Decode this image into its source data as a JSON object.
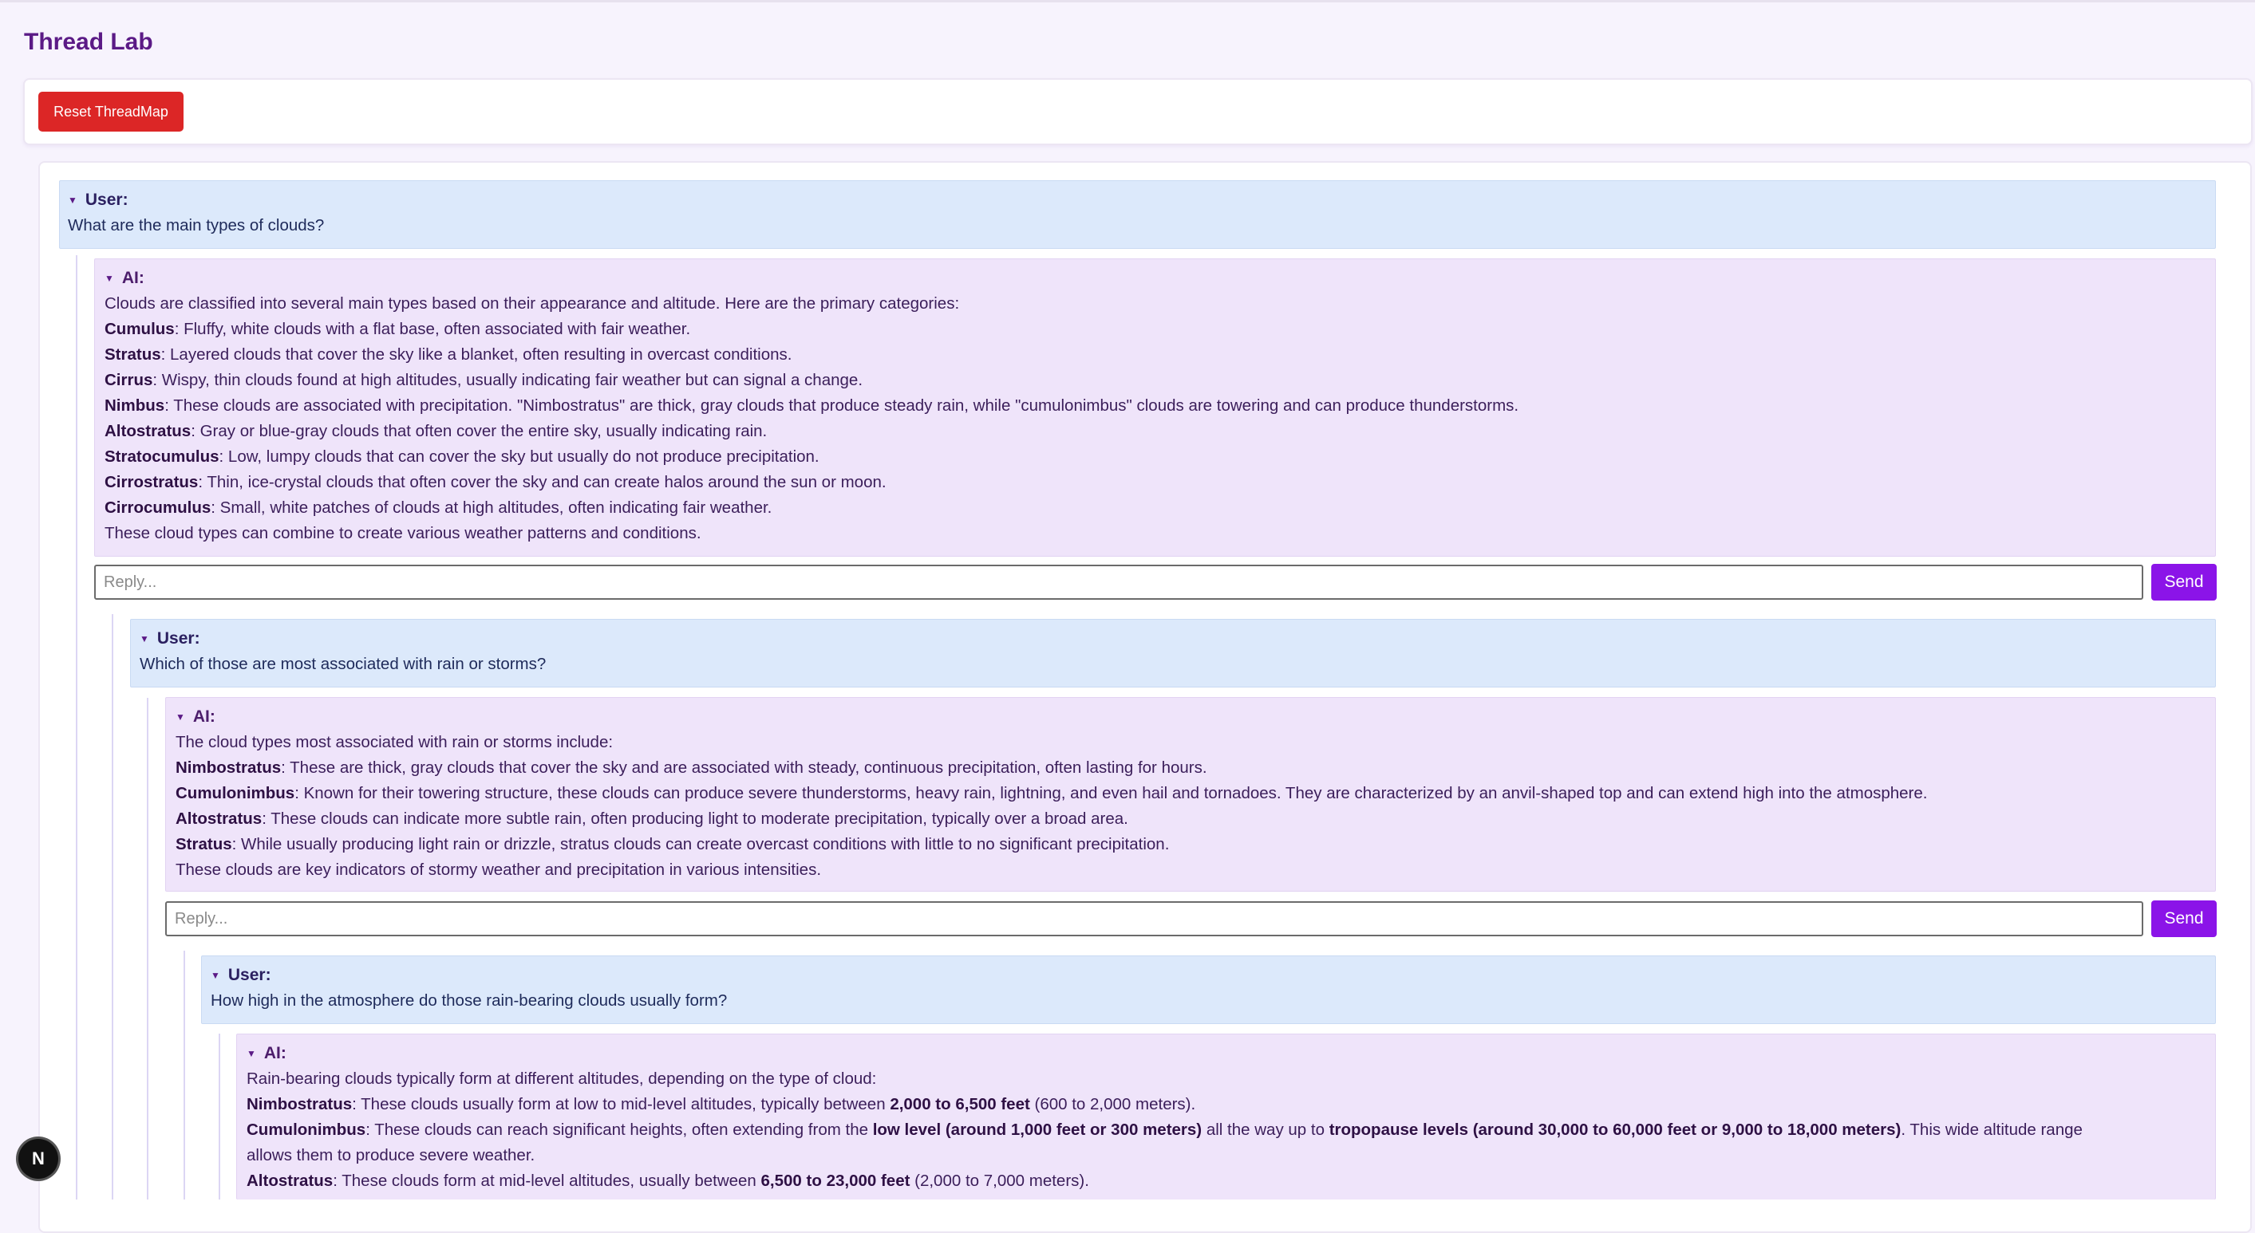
{
  "app": {
    "title": "Thread Lab",
    "reset_label": "Reset ThreadMap",
    "next_badge": "N"
  },
  "thread": {
    "q1": {
      "role": "User:",
      "text": "What are the main types of clouds?"
    },
    "a1": {
      "role": "AI:",
      "intro": "Clouds are classified into several main types based on their appearance and altitude. Here are the primary categories:",
      "items": [
        {
          "term": "Cumulus",
          "text": ": Fluffy, white clouds with a flat base, often associated with fair weather."
        },
        {
          "term": "Stratus",
          "text": ": Layered clouds that cover the sky like a blanket, often resulting in overcast conditions."
        },
        {
          "term": "Cirrus",
          "text": ": Wispy, thin clouds found at high altitudes, usually indicating fair weather but can signal a change."
        },
        {
          "term": "Nimbus",
          "text": ": These clouds are associated with precipitation. \"Nimbostratus\" are thick, gray clouds that produce steady rain, while \"cumulonimbus\" clouds are towering and can produce thunderstorms."
        },
        {
          "term": "Altostratus",
          "text": ": Gray or blue-gray clouds that often cover the entire sky, usually indicating rain."
        },
        {
          "term": "Stratocumulus",
          "text": ": Low, lumpy clouds that can cover the sky but usually do not produce precipitation."
        },
        {
          "term": "Cirrostratus",
          "text": ": Thin, ice-crystal clouds that often cover the sky and can create halos around the sun or moon."
        },
        {
          "term": "Cirrocumulus",
          "text": ": Small, white patches of clouds at high altitudes, often indicating fair weather."
        }
      ],
      "outro": "These cloud types can combine to create various weather patterns and conditions.",
      "reply_placeholder": "Reply...",
      "send_label": "Send"
    },
    "q2": {
      "role": "User:",
      "text": "Which of those are most associated with rain or storms?"
    },
    "a2": {
      "role": "AI:",
      "intro": "The cloud types most associated with rain or storms include:",
      "items": [
        {
          "term": "Nimbostratus",
          "text": ": These are thick, gray clouds that cover the sky and are associated with steady, continuous precipitation, often lasting for hours."
        },
        {
          "term": "Cumulonimbus",
          "text": ": Known for their towering structure, these clouds can produce severe thunderstorms, heavy rain, lightning, and even hail and tornadoes. They are characterized by an anvil-shaped top and can extend high into the atmosphere."
        },
        {
          "term": "Altostratus",
          "text": ": These clouds can indicate more subtle rain, often producing light to moderate precipitation, typically over a broad area."
        },
        {
          "term": "Stratus",
          "text": ": While usually producing light rain or drizzle, stratus clouds can create overcast conditions with little to no significant precipitation."
        }
      ],
      "outro": "These clouds are key indicators of stormy weather and precipitation in various intensities.",
      "reply_placeholder": "Reply...",
      "send_label": "Send"
    },
    "q3": {
      "role": "User:",
      "text": "How high in the atmosphere do those rain-bearing clouds usually form?"
    },
    "a3": {
      "role": "AI:",
      "intro": "Rain-bearing clouds typically form at different altitudes, depending on the type of cloud:",
      "l1": {
        "term": "Nimbostratus",
        "p1": ": These clouds usually form at low to mid-level altitudes, typically between ",
        "b1": "2,000 to 6,500 feet",
        "p2": " (600 to 2,000 meters)."
      },
      "l2": {
        "term": "Cumulonimbus",
        "p1": ": These clouds can reach significant heights, often extending from the ",
        "b1": "low level (around 1,000 feet or 300 meters)",
        "p2": " all the way up to ",
        "b2": "tropopause levels (around 30,000 to 60,000 feet or 9,000 to 18,000 meters)",
        "p3": ". This wide altitude range"
      },
      "l2b": "allows them to produce severe weather.",
      "l3": {
        "term": "Altostratus",
        "p1": ": These clouds form at mid-level altitudes, usually between ",
        "b1": "6,500 to 23,000 feet",
        "p2": " (2,000 to 7,000 meters)."
      }
    }
  }
}
